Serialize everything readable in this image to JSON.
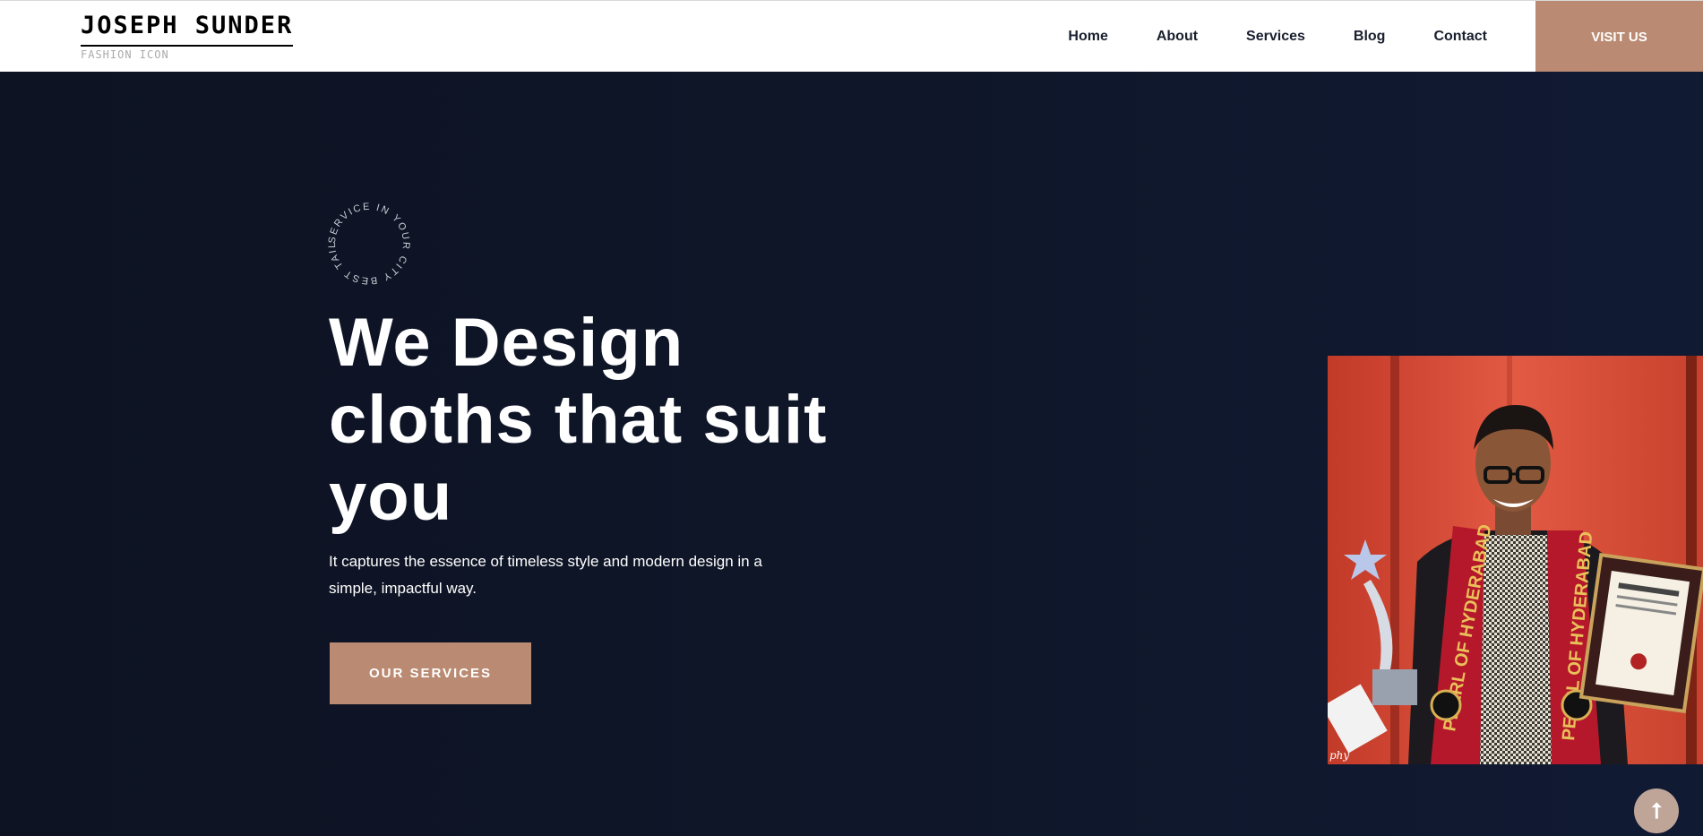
{
  "brand": {
    "name": "JOSEPH SUNDER",
    "tagline": "FASHION ICON"
  },
  "nav": {
    "items": [
      "Home",
      "About",
      "Services",
      "Blog",
      "Contact"
    ],
    "cta": "VISIT US"
  },
  "hero": {
    "badge_text": "SERVICE IN YOUR CITY BEST TAILOR ",
    "headline_lines": [
      "We Design",
      "cloths that suit",
      "you"
    ],
    "subtext": "It captures the essence of timeless style and modern design in a simple, impactful way.",
    "button": "OUR SERVICES"
  },
  "photo": {
    "scarf_text": "PEARL OF HYDERABAD",
    "watermark": "phy"
  },
  "scroll_top_icon": "arrow-up-icon",
  "colors": {
    "accent": "#ba8b72",
    "hero_bg": "#0e1426",
    "header_bg": "#ffffff"
  }
}
